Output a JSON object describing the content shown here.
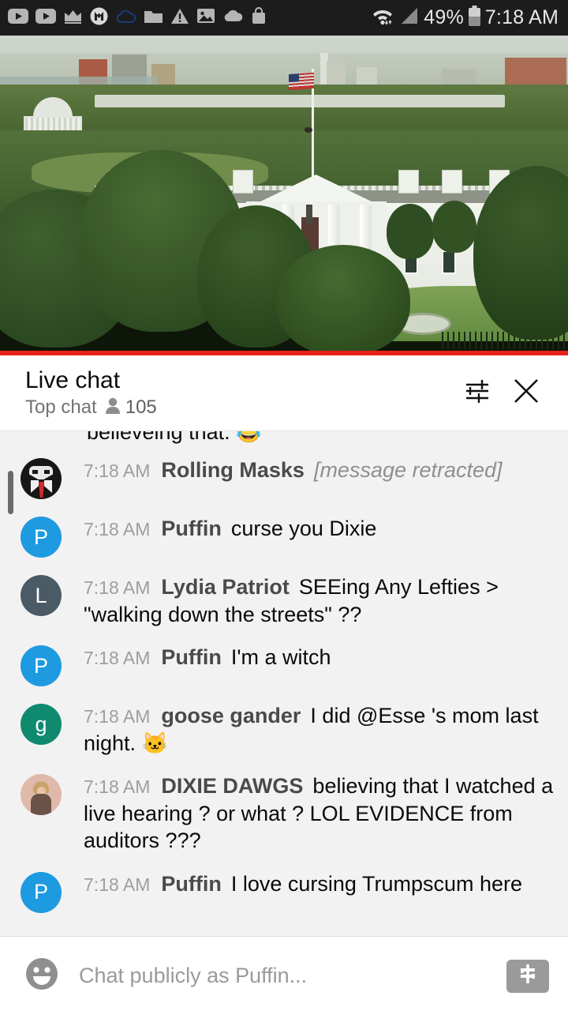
{
  "statusbar": {
    "icons": [
      "youtube-play-icon",
      "youtube-play-icon-2",
      "crown-icon",
      "m-circle-icon",
      "cloud-outline-icon",
      "folder-icon",
      "warning-triangle-icon",
      "photo-icon",
      "cloud-icon",
      "shopping-bag-icon"
    ],
    "wifi_icon": "wifi-icon",
    "signal_icon": "signal-bars-icon",
    "battery_percent": "49%",
    "battery_icon": "battery-icon",
    "time": "7:18 AM"
  },
  "video": {
    "scene_description": "White House north lawn live stream",
    "progress_color": "#e62117",
    "progress_percent": 100
  },
  "chat_header": {
    "title": "Live chat",
    "mode": "Top chat",
    "viewer_icon": "person-icon",
    "viewer_count": "105",
    "settings_icon": "chat-settings-sliders-icon",
    "close_icon": "close-icon"
  },
  "chat": {
    "clipped_message": {
      "text": "believeing that.",
      "emoji": "😂"
    },
    "messages": [
      {
        "time": "7:18 AM",
        "author": "Rolling Masks",
        "text": "[message retracted]",
        "retracted": true,
        "avatar_type": "mask-photo",
        "avatar_letter": "",
        "avatar_color": "#171717"
      },
      {
        "time": "7:18 AM",
        "author": "Puffin",
        "text": "curse you Dixie",
        "retracted": false,
        "avatar_type": "letter",
        "avatar_letter": "P",
        "avatar_color": "#1e9ae0"
      },
      {
        "time": "7:18 AM",
        "author": "Lydia Patriot",
        "text": "SEEing Any Lefties > \"walking down the streets\" ??",
        "retracted": false,
        "avatar_type": "letter",
        "avatar_letter": "L",
        "avatar_color": "#4b5b66"
      },
      {
        "time": "7:18 AM",
        "author": "Puffin",
        "text": "I'm a witch",
        "retracted": false,
        "avatar_type": "letter",
        "avatar_letter": "P",
        "avatar_color": "#1e9ae0"
      },
      {
        "time": "7:18 AM",
        "author": "goose gander",
        "text": "I did @Esse 's mom last night. 🐱",
        "retracted": false,
        "avatar_type": "letter",
        "avatar_letter": "g",
        "avatar_color": "#0f8a6e"
      },
      {
        "time": "7:18 AM",
        "author": "DIXIE DAWGS",
        "text": "believing that I watched a live hearing ? or what ? LOL EVIDENCE from auditors ???",
        "retracted": false,
        "avatar_type": "user-photo",
        "avatar_letter": "",
        "avatar_color": "#e0b9ab"
      },
      {
        "time": "7:18 AM",
        "author": "Puffin",
        "text": "I love cursing Trumpscum here",
        "retracted": false,
        "avatar_type": "letter",
        "avatar_letter": "P",
        "avatar_color": "#1e9ae0"
      }
    ]
  },
  "composer": {
    "emoji_icon": "emoji-smiley-icon",
    "placeholder": "Chat publicly as Puffin...",
    "value": "",
    "superchat_icon": "dollar-sign-icon"
  }
}
